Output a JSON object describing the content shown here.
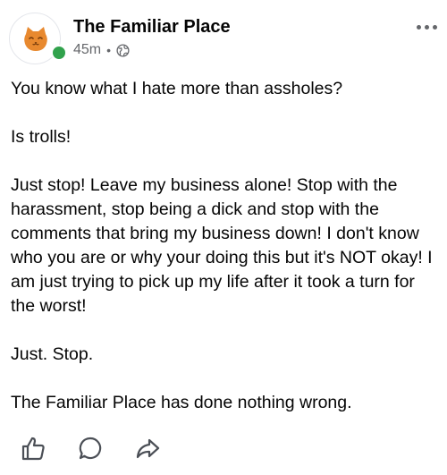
{
  "post": {
    "author": "The Familiar Place",
    "time": "45m",
    "separator": "•",
    "privacy_icon": "globe-icon",
    "avatar_icon": "cat-face-icon",
    "more_icon": "more-options-icon",
    "paragraphs": [
      "You know what I hate more than assholes?",
      "Is trolls!",
      "Just stop! Leave my business alone! Stop with the harassment, stop being a dick and stop with the comments that bring my business down! I don't know who you are or why your doing this but it's NOT okay! I am just trying to pick up my life after it took a turn for the worst!",
      "Just. Stop.",
      "The Familiar Place has done nothing wrong."
    ]
  },
  "actions": {
    "like_icon": "thumbs-up-icon",
    "comment_icon": "comment-icon",
    "share_icon": "share-icon"
  },
  "colors": {
    "online": "#31a24c",
    "avatar_orange": "#e8892f",
    "secondary_text": "#65676b"
  }
}
